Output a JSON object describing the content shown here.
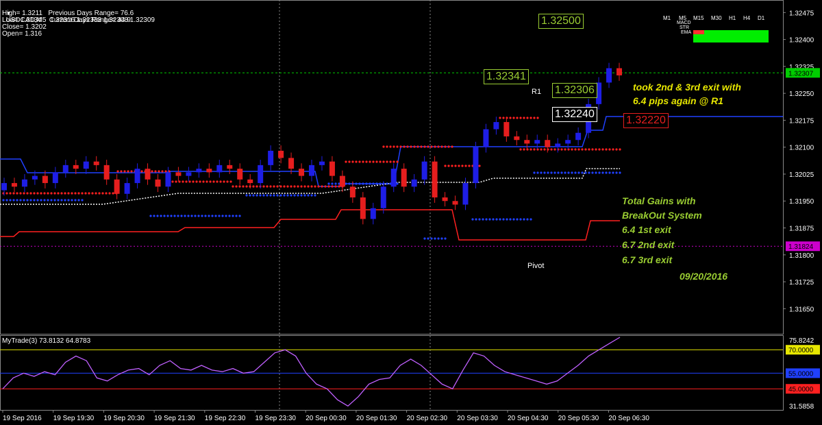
{
  "header": {
    "symbol_line": "USDCAD,M5  1.32316 1.32333 1.32308 1.32309",
    "high": "High= 1.3211",
    "low": "Low= 1.3134",
    "close": "Close= 1.3202",
    "open": "Open= 1.316",
    "prev_range": "Previous Days Range= 76.6",
    "curr_range": "Current Days Range= 44.9"
  },
  "timeframes": [
    "M1",
    "M5",
    "M15",
    "M30",
    "H1",
    "H4",
    "D1"
  ],
  "mini_labels": [
    "MACD",
    "STR",
    "EMA"
  ],
  "colors": {
    "background": "#000000",
    "grid": "#2a2a2a",
    "bull_candle": "#1e1ee6",
    "bear_candle": "#e61e1e",
    "green_line": "#00cc00",
    "yellow_text": "#e6e600",
    "green_text": "#9acd32",
    "oscillator": "#c060ff",
    "magenta": "#cc00cc"
  },
  "price_boxes": {
    "b1": "1.32500",
    "b2": "1.32341",
    "b3": "1.32306",
    "b4": "1.32240",
    "b5": "1.32220"
  },
  "line_labels": {
    "r1": "R1",
    "pivot": "Pivot"
  },
  "notes": {
    "exit_line1": "took 2nd & 3rd exit with",
    "exit_line2": "6.4 pips again @ R1",
    "gains_title1": "Total Gains with",
    "gains_title2": "BreakOut System",
    "exit1": "6.4 1st exit",
    "exit2": "6.7 2nd exit",
    "exit3": "6.7 3rd exit",
    "date": "09/20/2016"
  },
  "chart_data": {
    "type": "candlestick",
    "symbol": "USDCAD",
    "timeframe": "M5",
    "price_axis": {
      "ylim": [
        1.3158,
        1.3251
      ],
      "ticks": [
        "1.32475",
        "1.32400",
        "1.32325",
        "1.32250",
        "1.32175",
        "1.32100",
        "1.32025",
        "1.31950",
        "1.31875",
        "1.31800",
        "1.31725",
        "1.31650"
      ],
      "current_price": "1.32307",
      "pivot_price": "1.31824"
    },
    "x_labels": [
      "19 Sep 2016",
      "19 Sep 19:30",
      "19 Sep 20:30",
      "19 Sep 21:30",
      "19 Sep 22:30",
      "19 Sep 23:30",
      "20 Sep 00:30",
      "20 Sep 01:30",
      "20 Sep 02:30",
      "20 Sep 03:30",
      "20 Sep 04:30",
      "20 Sep 05:30",
      "20 Sep 06:30"
    ],
    "close_path": [
      1.32,
      1.3199,
      1.3201,
      1.3202,
      1.32,
      1.3203,
      1.3205,
      1.3204,
      1.3206,
      1.3205,
      1.3201,
      1.3197,
      1.32,
      1.3204,
      1.3201,
      1.3199,
      1.3203,
      1.3202,
      1.3203,
      1.3204,
      1.3203,
      1.3205,
      1.3204,
      1.3201,
      1.32,
      1.3205,
      1.3209,
      1.3207,
      1.3204,
      1.3202,
      1.3205,
      1.3206,
      1.3202,
      1.3199,
      1.3196,
      1.319,
      1.3193,
      1.3199,
      1.3204,
      1.3199,
      1.3201,
      1.3206,
      1.3196,
      1.3195,
      1.3194,
      1.32,
      1.321,
      1.3215,
      1.3217,
      1.3213,
      1.3212,
      1.3211,
      1.3212,
      1.321,
      1.3211,
      1.3212,
      1.3214,
      1.3222,
      1.3228,
      1.3232,
      1.323
    ],
    "oscillator": {
      "name": "MyTrade(3) 73.8132 64.8783",
      "ylim": [
        31.5,
        78
      ],
      "levels": {
        "upper": "70.0000",
        "mid": "55.0000",
        "lower": "45.0000"
      },
      "axis_top": "75.8242",
      "axis_bottom": "31.5858",
      "values": [
        45,
        52,
        55,
        53,
        56,
        54,
        62,
        66,
        63,
        52,
        50,
        54,
        57,
        58,
        54,
        60,
        63,
        58,
        57,
        60,
        57,
        56,
        58,
        55,
        56,
        62,
        68,
        70,
        66,
        55,
        48,
        45,
        38,
        34,
        40,
        48,
        51,
        52,
        60,
        64,
        60,
        54,
        48,
        45,
        57,
        68,
        66,
        60,
        56,
        54,
        52,
        50,
        48,
        50,
        55,
        60,
        66,
        70,
        74,
        78
      ]
    }
  }
}
